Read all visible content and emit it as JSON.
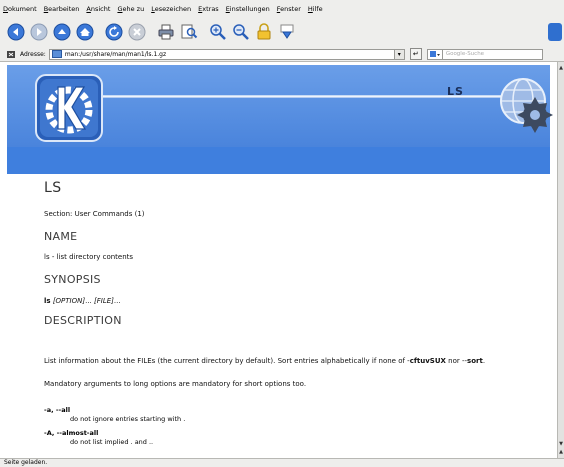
{
  "menu": [
    "Dokument",
    "Bearbeiten",
    "Ansicht",
    "Gehe zu",
    "Lesezeichen",
    "Extras",
    "Einstellungen",
    "Fenster",
    "Hilfe"
  ],
  "colors": {
    "accent": "#3f7fde",
    "toolbar_bg": "#eeeeec"
  },
  "toolbar": {
    "buttons": [
      "back-icon",
      "forward-icon",
      "up-icon",
      "home-icon",
      "reload-icon",
      "stop-icon",
      "print-icon",
      "find-icon",
      "zoom-in-icon",
      "zoom-out-icon",
      "security-lock-icon",
      "bookmark-icon"
    ]
  },
  "address": {
    "label": "Adresse:",
    "value": "man:/usr/share/man/man1/ls.1.gz",
    "search_placeholder": "Google-Suche"
  },
  "banner": {
    "title": "LS"
  },
  "page": {
    "title": "LS",
    "section": "Section: User Commands (1)",
    "name_heading": "NAME",
    "name_text": "ls - list directory contents",
    "synopsis_heading": "SYNOPSIS",
    "synopsis_cmd": "ls",
    "synopsis_opt": "[OPTION]",
    "synopsis_sep": "... ",
    "synopsis_file": "[FILE]",
    "synopsis_end": "...",
    "description_heading": "DESCRIPTION",
    "desc1_a": "List information about the FILEs (the current directory by default). Sort entries alphabetically if none of -",
    "desc1_b": "cftuvSUX",
    "desc1_c": " nor --",
    "desc1_d": "sort",
    "desc1_e": ".",
    "desc2": "Mandatory arguments to long options are mandatory for short options too.",
    "options": [
      {
        "flag": "-a, --all",
        "desc": "do not ignore entries starting with ."
      },
      {
        "flag": "-A, --almost-all",
        "desc": "do not list implied . and .."
      }
    ]
  },
  "status": "Seite geladen."
}
